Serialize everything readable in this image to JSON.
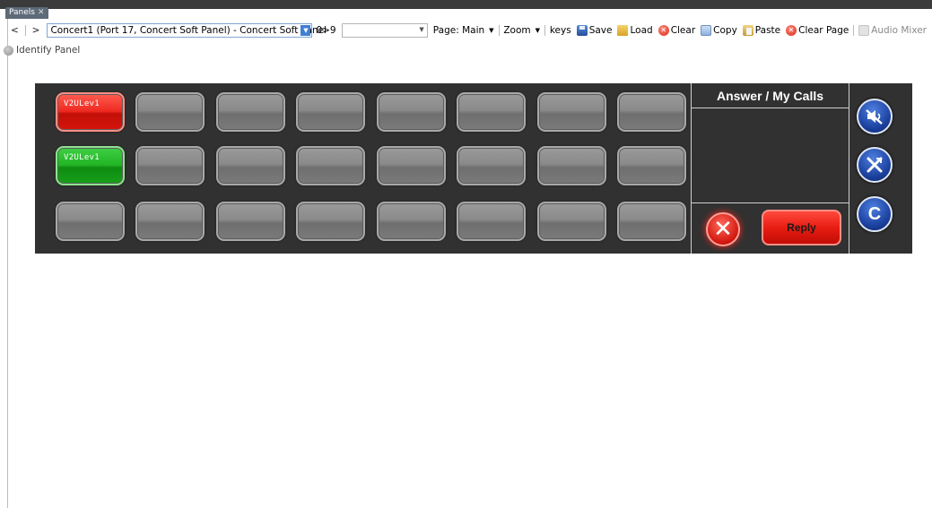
{
  "tab": {
    "label": "Panels",
    "close": "✕"
  },
  "toolbar": {
    "back": "<",
    "forward": ">",
    "panel_select": "Concert1    (Port 17, Concert Soft Panel)  -  Concert Soft Panel",
    "keys_range": "0>9",
    "page": "Page: Main",
    "zoom": "Zoom",
    "keys": "keys",
    "save": "Save",
    "load": "Load",
    "clear": "Clear",
    "copy": "Copy",
    "paste": "Paste",
    "clear_page": "Clear Page",
    "audio_mixer": "Audio Mixer"
  },
  "identify": "Identify Panel",
  "panel": {
    "keys": [
      [
        {
          "label": "V2ULev1",
          "state": "red"
        },
        {
          "label": "",
          "state": "idle"
        },
        {
          "label": "",
          "state": "idle"
        },
        {
          "label": "",
          "state": "idle"
        },
        {
          "label": "",
          "state": "idle"
        },
        {
          "label": "",
          "state": "idle"
        },
        {
          "label": "",
          "state": "idle"
        },
        {
          "label": "",
          "state": "idle"
        }
      ],
      [
        {
          "label": "V2ULev1",
          "state": "green"
        },
        {
          "label": "",
          "state": "idle"
        },
        {
          "label": "",
          "state": "idle"
        },
        {
          "label": "",
          "state": "idle"
        },
        {
          "label": "",
          "state": "idle"
        },
        {
          "label": "",
          "state": "idle"
        },
        {
          "label": "",
          "state": "idle"
        },
        {
          "label": "",
          "state": "idle"
        }
      ],
      [
        {
          "label": "",
          "state": "idle"
        },
        {
          "label": "",
          "state": "idle"
        },
        {
          "label": "",
          "state": "idle"
        },
        {
          "label": "",
          "state": "idle"
        },
        {
          "label": "",
          "state": "idle"
        },
        {
          "label": "",
          "state": "idle"
        },
        {
          "label": "",
          "state": "idle"
        },
        {
          "label": "",
          "state": "idle"
        }
      ]
    ],
    "answer_title": "Answer / My Calls",
    "reply": "Reply",
    "side_c": "C"
  },
  "colors": {
    "panel_bg": "#313131",
    "key_red": "#e81d12",
    "key_green": "#22b526",
    "side_blue": "#1a3f9c"
  }
}
